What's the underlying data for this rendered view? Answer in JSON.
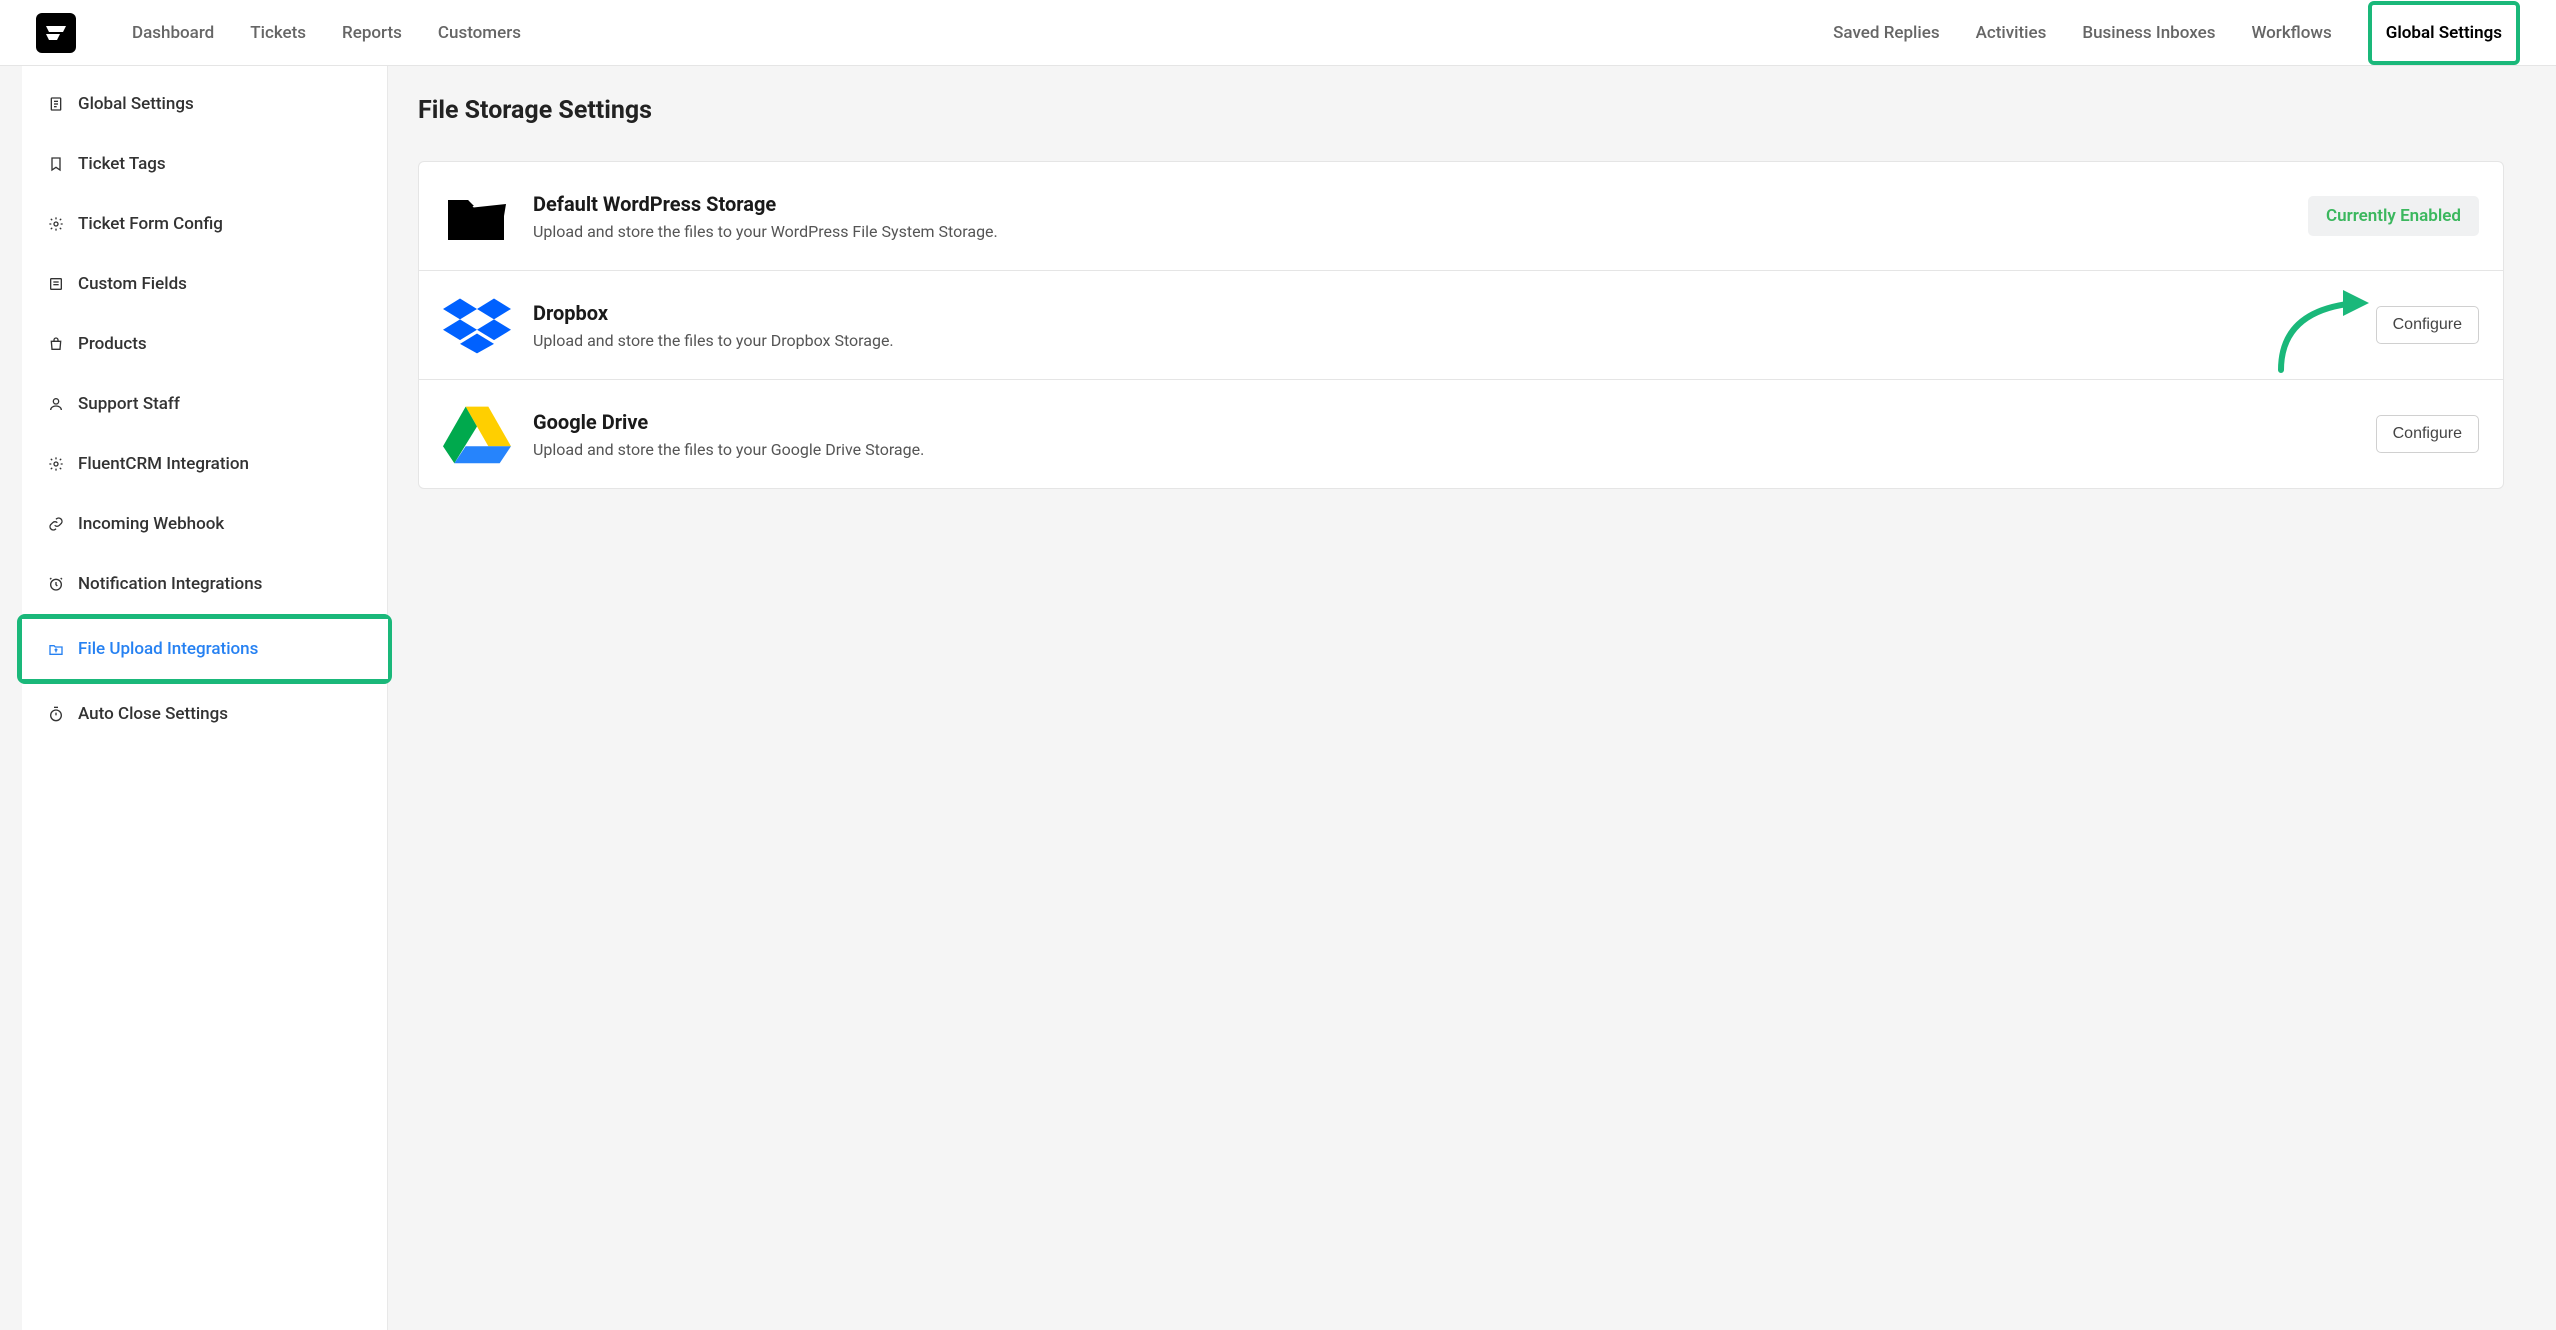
{
  "nav": {
    "left": [
      "Dashboard",
      "Tickets",
      "Reports",
      "Customers"
    ],
    "right": [
      "Saved Replies",
      "Activities",
      "Business Inboxes",
      "Workflows",
      "Global Settings"
    ]
  },
  "sidebar": {
    "items": [
      {
        "label": "Global Settings"
      },
      {
        "label": "Ticket Tags"
      },
      {
        "label": "Ticket Form Config"
      },
      {
        "label": "Custom Fields"
      },
      {
        "label": "Products"
      },
      {
        "label": "Support Staff"
      },
      {
        "label": "FluentCRM Integration"
      },
      {
        "label": "Incoming Webhook"
      },
      {
        "label": "Notification Integrations"
      },
      {
        "label": "File Upload Integrations"
      },
      {
        "label": "Auto Close Settings"
      }
    ]
  },
  "page": {
    "title": "File Storage Settings"
  },
  "storage": [
    {
      "title": "Default WordPress Storage",
      "desc": "Upload and store the files to your WordPress File System Storage.",
      "action": "Currently Enabled"
    },
    {
      "title": "Dropbox",
      "desc": "Upload and store the files to your Dropbox Storage.",
      "action": "Configure"
    },
    {
      "title": "Google Drive",
      "desc": "Upload and store the files to your Google Drive Storage.",
      "action": "Configure"
    }
  ]
}
